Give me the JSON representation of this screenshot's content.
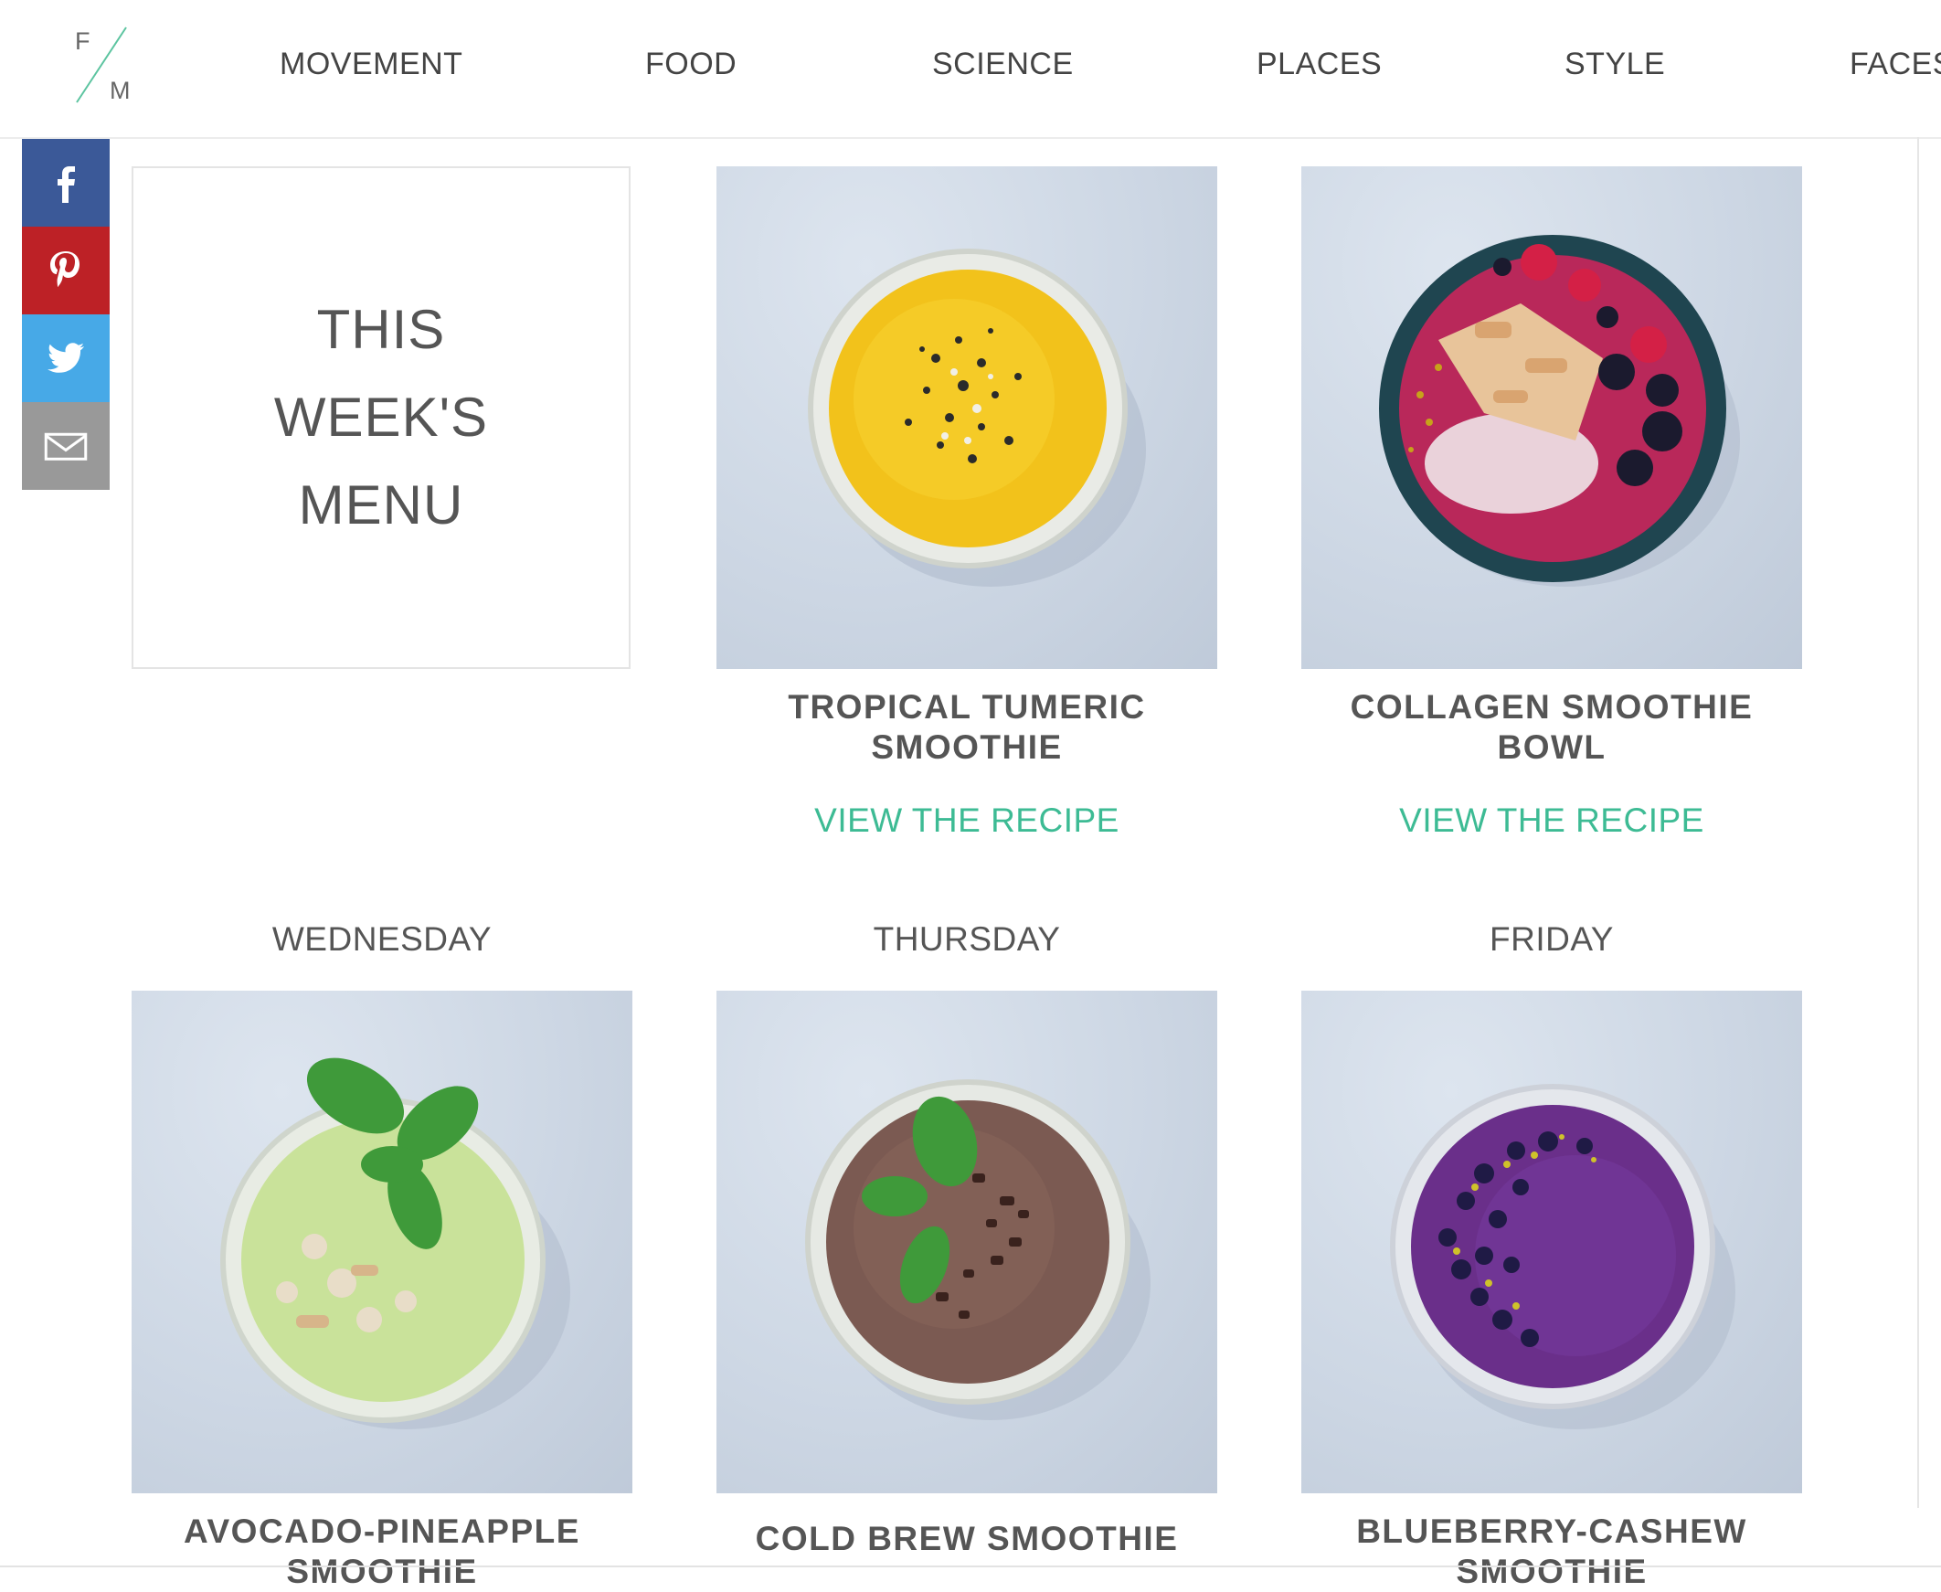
{
  "logo": {
    "top_letter": "F",
    "bottom_letter": "M"
  },
  "nav": [
    "MOVEMENT",
    "FOOD",
    "SCIENCE",
    "PLACES",
    "STYLE",
    "FACES"
  ],
  "share": [
    "facebook-icon",
    "pinterest-icon",
    "twitter-icon",
    "email-icon"
  ],
  "menu_card": {
    "lines": [
      "THIS",
      "WEEK'S",
      "MENU"
    ]
  },
  "link_label": "VIEW THE RECIPE",
  "days": [
    "WEDNESDAY",
    "THURSDAY",
    "FRIDAY"
  ],
  "recipes": [
    {
      "title_line1": "TROPICAL TUMERIC",
      "title_line2": "SMOOTHIE"
    },
    {
      "title_line1": "COLLAGEN SMOOTHIE",
      "title_line2": "BOWL"
    },
    {
      "title_line1": "AVOCADO-PINEAPPLE",
      "title_line2": "SMOOTHIE"
    },
    {
      "title_line1": "COLD BREW SMOOTHIE"
    },
    {
      "title_line1": "BLUEBERRY-CASHEW",
      "title_line2": "SMOOTHIE"
    }
  ],
  "colors": {
    "accent": "#3dbb94",
    "facebook": "#3b5998",
    "pinterest": "#bd2126",
    "twitter": "#47a9e7",
    "email": "#999999"
  }
}
